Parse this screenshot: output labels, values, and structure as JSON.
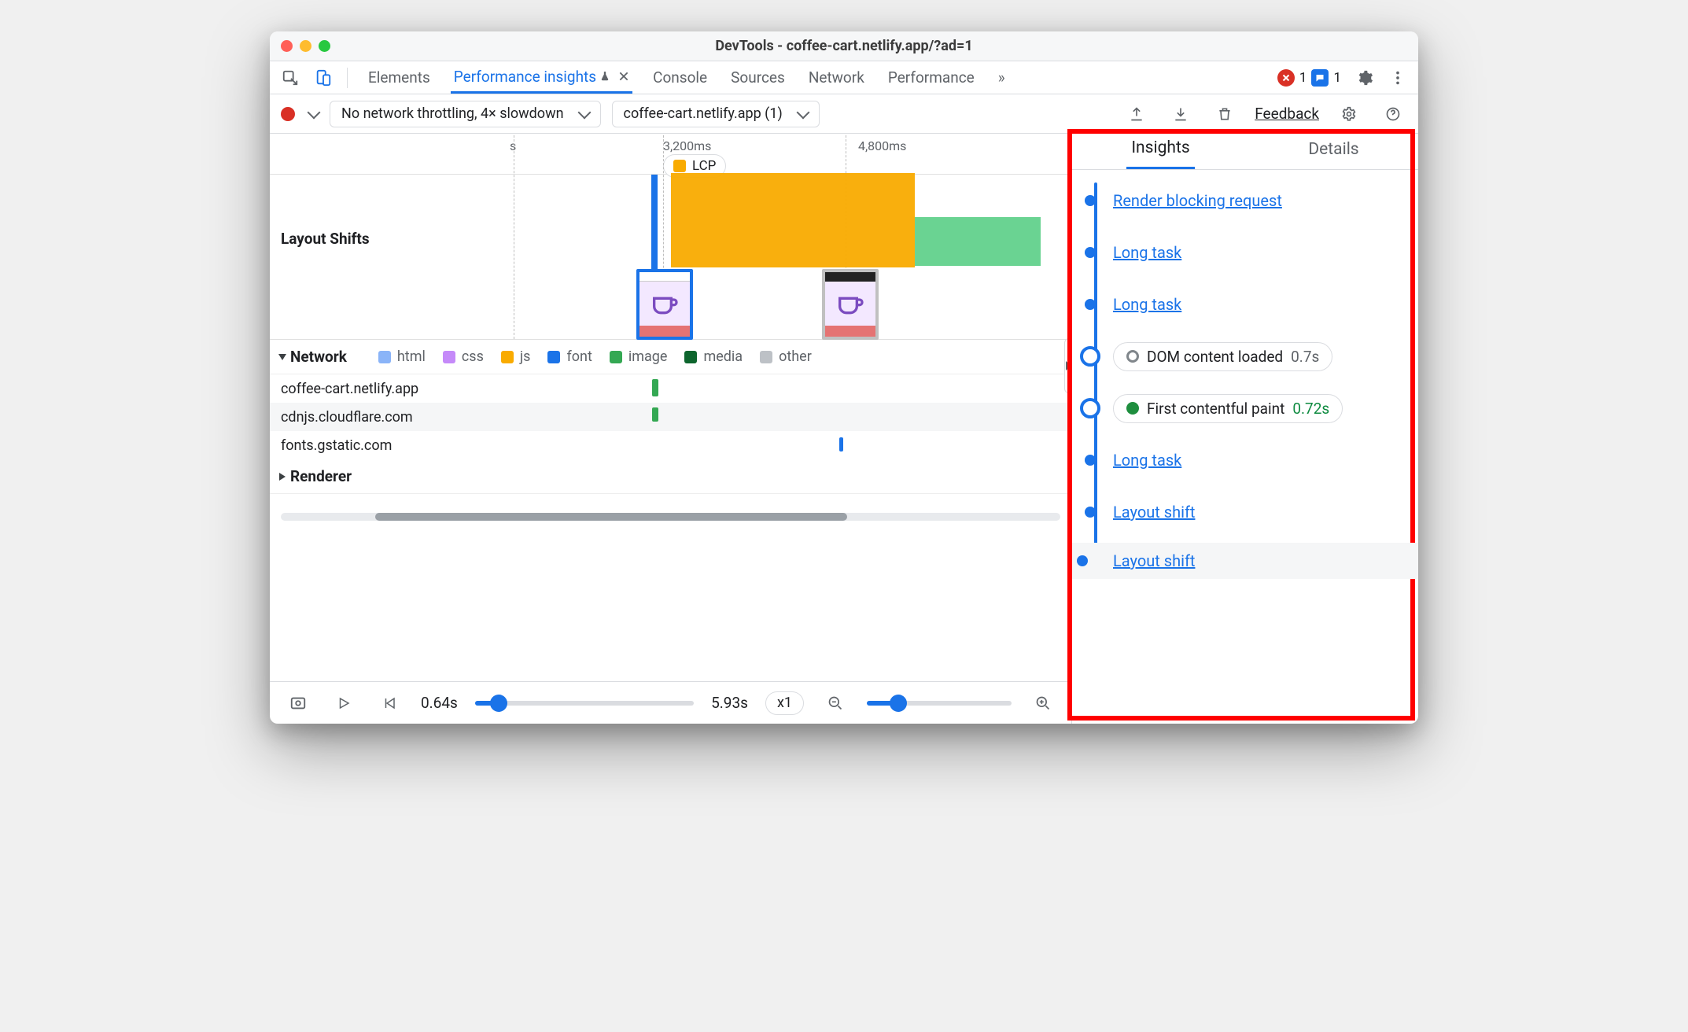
{
  "window": {
    "title": "DevTools - coffee-cart.netlify.app/?ad=1"
  },
  "toolbar": {
    "tabs": {
      "elements": "Elements",
      "perf_insights": "Performance insights",
      "console": "Console",
      "sources": "Sources",
      "network": "Network",
      "performance": "Performance"
    },
    "more_glyph": "»",
    "errors_count": "1",
    "messages_count": "1"
  },
  "controls": {
    "throttling": "No network throttling, 4× slowdown",
    "page_select": "coffee-cart.netlify.app (1)",
    "feedback": "Feedback"
  },
  "ruler": {
    "s_label": "s",
    "t1": "3,200ms",
    "t2": "4,800ms",
    "lcp_label": "LCP"
  },
  "sections": {
    "layout_shifts": "Layout Shifts",
    "network": "Network",
    "renderer": "Renderer"
  },
  "legend": {
    "html": {
      "label": "html",
      "color": "#8AB4F8"
    },
    "css": {
      "label": "css",
      "color": "#C58AF9"
    },
    "js": {
      "label": "js",
      "color": "#F9AB00"
    },
    "font": {
      "label": "font",
      "color": "#1A73E8"
    },
    "image": {
      "label": "image",
      "color": "#34A853"
    },
    "media": {
      "label": "media",
      "color": "#0D652D"
    },
    "other": {
      "label": "other",
      "color": "#BDC1C6"
    }
  },
  "network_hosts": [
    "coffee-cart.netlify.app",
    "cdnjs.cloudflare.com",
    "fonts.gstatic.com"
  ],
  "player": {
    "start": "0.64s",
    "end": "5.93s",
    "zoom": "x1"
  },
  "right": {
    "tabs": {
      "insights": "Insights",
      "details": "Details"
    },
    "items": [
      {
        "kind": "link",
        "label": "Render blocking request"
      },
      {
        "kind": "link",
        "label": "Long task"
      },
      {
        "kind": "link",
        "label": "Long task"
      },
      {
        "kind": "event",
        "label": "DOM content loaded",
        "time": "0.7s",
        "status": "grey"
      },
      {
        "kind": "event",
        "label": "First contentful paint",
        "time": "0.72s",
        "status": "green"
      },
      {
        "kind": "link",
        "label": "Long task"
      },
      {
        "kind": "link",
        "label": "Layout shift"
      },
      {
        "kind": "link",
        "label": "Layout shift"
      }
    ]
  }
}
